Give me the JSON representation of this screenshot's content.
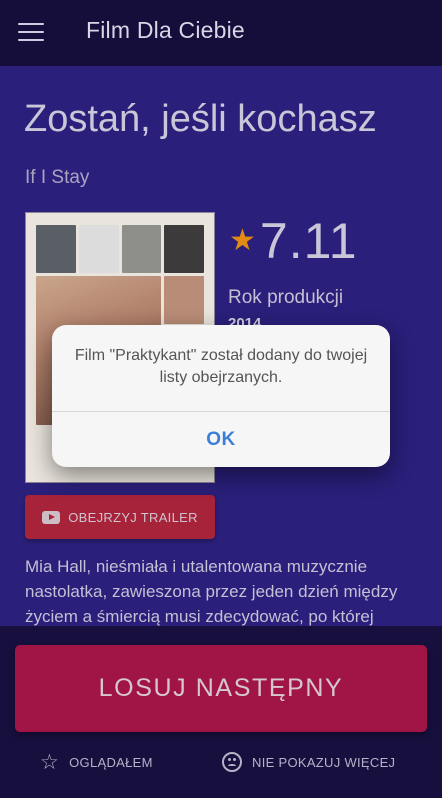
{
  "appbar": {
    "title": "Film Dla Ciebie"
  },
  "movie": {
    "title": "Zostań, jeśli kochasz",
    "original_title": "If I Stay",
    "rating": "7.11",
    "year_label": "Rok produkcji",
    "year": "2014",
    "trailer_label": "OBEJRZYJ TRAILER",
    "description": "Mia Hall, nieśmiała i utalentowana muzycznie nastolatka, zawieszona przez jeden dzień między życiem a śmiercią musi zdecydować, po której"
  },
  "bottom": {
    "random_label": "LOSUJ NASTĘPNY",
    "watched_label": "OGLĄDAŁEM",
    "dont_show_label": "NIE POKAZUJ WIĘCEJ"
  },
  "dialog": {
    "message": "Film \"Praktykant\" został dodany do twojej listy obejrzanych.",
    "ok_label": "OK"
  },
  "colors": {
    "appbar": "#150d3a",
    "content_bg": "#2a1f7a",
    "accent_star": "#e38a14",
    "trailer_button": "#a6233a",
    "random_button": "#a01546",
    "dialog_ok": "#3c7fd6"
  },
  "icons": {
    "menu": "menu-icon",
    "star": "star-icon",
    "youtube": "youtube-icon",
    "star_outline": "star-outline-icon",
    "sad_face": "sad-face-icon"
  }
}
